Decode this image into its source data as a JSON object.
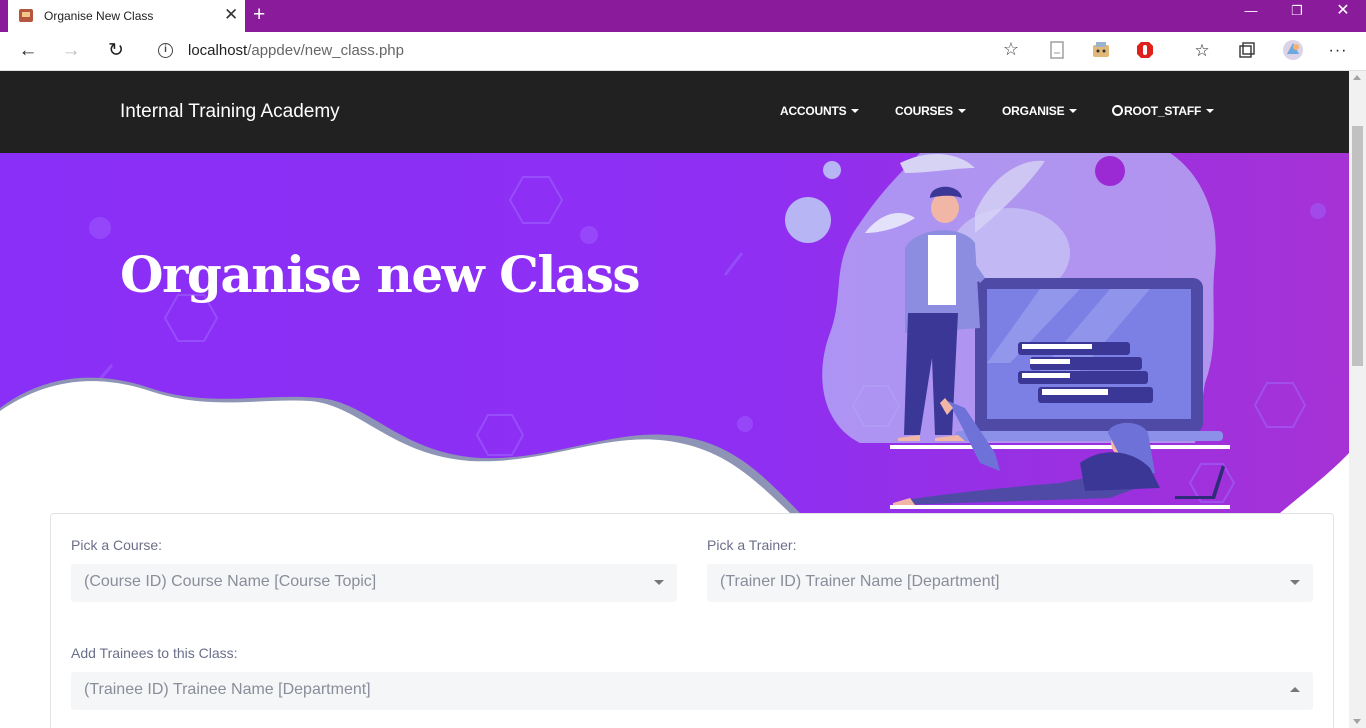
{
  "browser": {
    "tab_title": "Organise New Class",
    "url_host": "localhost",
    "url_path": "/appdev/new_class.php",
    "frame_color": "#8a1c9c"
  },
  "site": {
    "brand": "Internal Training Academy",
    "menu": [
      "ACCOUNTS",
      "COURSES",
      "ORGANISE",
      "ROOT_STAFF"
    ],
    "nav_bg": "#212121"
  },
  "hero": {
    "title": "Organise new Class",
    "bg": "#8a2ff7"
  },
  "form": {
    "course_label": "Pick a Course:",
    "course_placeholder": "(Course ID) Course Name [Course Topic]",
    "trainer_label": "Pick a Trainer:",
    "trainer_placeholder": "(Trainer ID) Trainer Name [Department]",
    "trainees_label": "Add Trainees to this Class:",
    "trainees_placeholder": "(Trainee ID) Trainee Name [Department]"
  }
}
